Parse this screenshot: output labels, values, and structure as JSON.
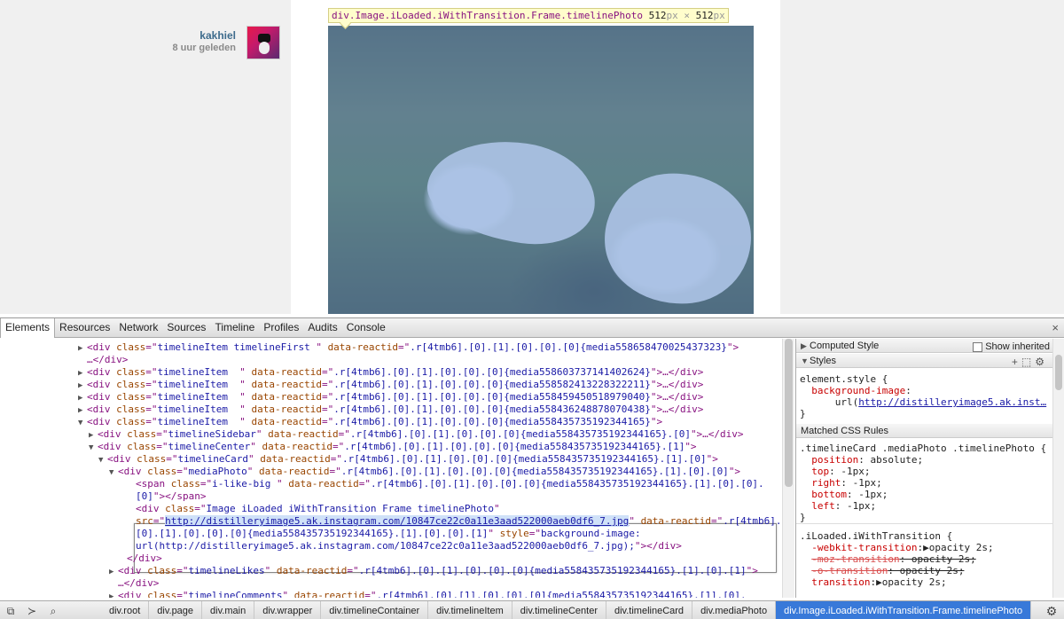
{
  "page": {
    "author_name": "kakhiel",
    "time_ago": "8 uur geleden",
    "tooltip": {
      "selector": "div.Image.iLoaded.iWithTransition.Frame.timelinePhoto",
      "width": "512",
      "height": "512",
      "unit": "px",
      "sep": " × "
    }
  },
  "devtools": {
    "tabs": [
      "Elements",
      "Resources",
      "Network",
      "Sources",
      "Timeline",
      "Profiles",
      "Audits",
      "Console"
    ],
    "close_glyph": "×",
    "dom": [
      {
        "i": 98,
        "tri": "▶",
        "parts": [
          [
            "tg",
            "<div "
          ],
          [
            "an",
            "class"
          ],
          [
            "tg",
            "=\""
          ],
          [
            "av",
            "timelineItem timelineFirst "
          ],
          [
            "tg",
            "\" "
          ],
          [
            "an",
            "data-reactid"
          ],
          [
            "tg",
            "=\""
          ],
          [
            "av",
            ".r[4tmb6].[0].[1].[0].[0].[0]{media558658470025437323}"
          ],
          [
            "tg",
            "\">"
          ]
        ]
      },
      {
        "i": 98,
        "tri": "",
        "parts": [
          [
            "tg",
            "…</div>"
          ]
        ]
      },
      {
        "i": 98,
        "tri": "▶",
        "parts": [
          [
            "tg",
            "<div "
          ],
          [
            "an",
            "class"
          ],
          [
            "tg",
            "=\""
          ],
          [
            "av",
            "timelineItem  "
          ],
          [
            "tg",
            "\" "
          ],
          [
            "an",
            "data-reactid"
          ],
          [
            "tg",
            "=\""
          ],
          [
            "av",
            ".r[4tmb6].[0].[1].[0].[0].[0]{media558603737141402624}"
          ],
          [
            "tg",
            "\">…</div>"
          ]
        ]
      },
      {
        "i": 98,
        "tri": "▶",
        "parts": [
          [
            "tg",
            "<div "
          ],
          [
            "an",
            "class"
          ],
          [
            "tg",
            "=\""
          ],
          [
            "av",
            "timelineItem  "
          ],
          [
            "tg",
            "\" "
          ],
          [
            "an",
            "data-reactid"
          ],
          [
            "tg",
            "=\""
          ],
          [
            "av",
            ".r[4tmb6].[0].[1].[0].[0].[0]{media558582413228322211}"
          ],
          [
            "tg",
            "\">…</div>"
          ]
        ]
      },
      {
        "i": 98,
        "tri": "▶",
        "parts": [
          [
            "tg",
            "<div "
          ],
          [
            "an",
            "class"
          ],
          [
            "tg",
            "=\""
          ],
          [
            "av",
            "timelineItem  "
          ],
          [
            "tg",
            "\" "
          ],
          [
            "an",
            "data-reactid"
          ],
          [
            "tg",
            "=\""
          ],
          [
            "av",
            ".r[4tmb6].[0].[1].[0].[0].[0]{media558459450518979040}"
          ],
          [
            "tg",
            "\">…</div>"
          ]
        ]
      },
      {
        "i": 98,
        "tri": "▶",
        "parts": [
          [
            "tg",
            "<div "
          ],
          [
            "an",
            "class"
          ],
          [
            "tg",
            "=\""
          ],
          [
            "av",
            "timelineItem  "
          ],
          [
            "tg",
            "\" "
          ],
          [
            "an",
            "data-reactid"
          ],
          [
            "tg",
            "=\""
          ],
          [
            "av",
            ".r[4tmb6].[0].[1].[0].[0].[0]{media558436248878070438}"
          ],
          [
            "tg",
            "\">…</div>"
          ]
        ]
      },
      {
        "i": 98,
        "tri": "▼",
        "parts": [
          [
            "tg",
            "<div "
          ],
          [
            "an",
            "class"
          ],
          [
            "tg",
            "=\""
          ],
          [
            "av",
            "timelineItem  "
          ],
          [
            "tg",
            "\" "
          ],
          [
            "an",
            "data-reactid"
          ],
          [
            "tg",
            "=\""
          ],
          [
            "av",
            ".r[4tmb6].[0].[1].[0].[0].[0]{media558435735192344165}"
          ],
          [
            "tg",
            "\">"
          ]
        ]
      },
      {
        "i": 110,
        "tri": "▶",
        "parts": [
          [
            "tg",
            "<div "
          ],
          [
            "an",
            "class"
          ],
          [
            "tg",
            "=\""
          ],
          [
            "av",
            "timelineSidebar"
          ],
          [
            "tg",
            "\" "
          ],
          [
            "an",
            "data-reactid"
          ],
          [
            "tg",
            "=\""
          ],
          [
            "av",
            ".r[4tmb6].[0].[1].[0].[0].[0]{media558435735192344165}.[0]"
          ],
          [
            "tg",
            "\">…</div>"
          ]
        ]
      },
      {
        "i": 110,
        "tri": "▼",
        "parts": [
          [
            "tg",
            "<div "
          ],
          [
            "an",
            "class"
          ],
          [
            "tg",
            "=\""
          ],
          [
            "av",
            "timelineCenter"
          ],
          [
            "tg",
            "\" "
          ],
          [
            "an",
            "data-reactid"
          ],
          [
            "tg",
            "=\""
          ],
          [
            "av",
            ".r[4tmb6].[0].[1].[0].[0].[0]{media558435735192344165}.[1]"
          ],
          [
            "tg",
            "\">"
          ]
        ]
      },
      {
        "i": 121,
        "tri": "▼",
        "parts": [
          [
            "tg",
            "<div "
          ],
          [
            "an",
            "class"
          ],
          [
            "tg",
            "=\""
          ],
          [
            "av",
            "timelineCard"
          ],
          [
            "tg",
            "\" "
          ],
          [
            "an",
            "data-reactid"
          ],
          [
            "tg",
            "=\""
          ],
          [
            "av",
            ".r[4tmb6].[0].[1].[0].[0].[0]{media558435735192344165}.[1].[0]"
          ],
          [
            "tg",
            "\">"
          ]
        ]
      },
      {
        "i": 133,
        "tri": "▼",
        "parts": [
          [
            "tg",
            "<div "
          ],
          [
            "an",
            "class"
          ],
          [
            "tg",
            "=\""
          ],
          [
            "av",
            "mediaPhoto"
          ],
          [
            "tg",
            "\" "
          ],
          [
            "an",
            "data-reactid"
          ],
          [
            "tg",
            "=\""
          ],
          [
            "av",
            ".r[4tmb6].[0].[1].[0].[0].[0]{media558435735192344165}.[1].[0].[0]"
          ],
          [
            "tg",
            "\">"
          ]
        ]
      },
      {
        "i": 153,
        "tri": "",
        "parts": [
          [
            "tg",
            "<span "
          ],
          [
            "an",
            "class"
          ],
          [
            "tg",
            "=\""
          ],
          [
            "av",
            "i-like-big "
          ],
          [
            "tg",
            "\" "
          ],
          [
            "an",
            "data-reactid"
          ],
          [
            "tg",
            "=\""
          ],
          [
            "av",
            ".r[4tmb6].[0].[1].[0].[0].[0]{media558435735192344165}.[1].[0].[0]."
          ]
        ]
      },
      {
        "i": 153,
        "tri": "",
        "parts": [
          [
            "av",
            "[0]"
          ],
          [
            "tg",
            "\"></span>"
          ]
        ]
      },
      {
        "i": 153,
        "tri": "",
        "parts": [
          [
            "tg",
            "<div "
          ],
          [
            "an",
            "class"
          ],
          [
            "tg",
            "=\""
          ],
          [
            "av",
            "Image iLoaded iWithTransition Frame timelinePhoto"
          ],
          [
            "tg",
            "\""
          ]
        ]
      },
      {
        "i": 153,
        "tri": "",
        "parts": [
          [
            "an",
            "src"
          ],
          [
            "tg",
            "=\""
          ],
          [
            "link",
            "http://distilleryimage5.ak.instagram.com/10847ce22c0a11e3aad522000aeb0df6_7.jpg"
          ],
          [
            "tg",
            "\" "
          ],
          [
            "an",
            "data-reactid"
          ],
          [
            "tg",
            "=\""
          ],
          [
            "av",
            ".r[4tmb6]."
          ]
        ]
      },
      {
        "i": 153,
        "tri": "",
        "parts": [
          [
            "av",
            "[0].[1].[0].[0].[0]{media558435735192344165}.[1].[0].[0].[1]"
          ],
          [
            "tg",
            "\" "
          ],
          [
            "an",
            "style"
          ],
          [
            "tg",
            "=\""
          ],
          [
            "av",
            "background-image:"
          ]
        ]
      },
      {
        "i": 153,
        "tri": "",
        "parts": [
          [
            "av",
            "url(http://distilleryimage5.ak.instagram.com/10847ce22c0a11e3aad522000aeb0df6_7.jpg);"
          ],
          [
            "tg",
            "\"></div>"
          ]
        ]
      },
      {
        "i": 143,
        "tri": "",
        "parts": [
          [
            "tg",
            "</div>"
          ]
        ]
      },
      {
        "i": 133,
        "tri": "▶",
        "parts": [
          [
            "tg",
            "<div "
          ],
          [
            "an",
            "class"
          ],
          [
            "tg",
            "=\""
          ],
          [
            "av",
            "timelineLikes"
          ],
          [
            "tg",
            "\" "
          ],
          [
            "an",
            "data-reactid"
          ],
          [
            "tg",
            "=\""
          ],
          [
            "av",
            ".r[4tmb6].[0].[1].[0].[0].[0]{media558435735192344165}.[1].[0].[1]"
          ],
          [
            "tg",
            "\">"
          ]
        ]
      },
      {
        "i": 133,
        "tri": "",
        "parts": [
          [
            "tg",
            "…</div>"
          ]
        ]
      },
      {
        "i": 133,
        "tri": "▶",
        "parts": [
          [
            "tg",
            "<div "
          ],
          [
            "an",
            "class"
          ],
          [
            "tg",
            "=\""
          ],
          [
            "av",
            "timelineComments"
          ],
          [
            "tg",
            "\" "
          ],
          [
            "an",
            "data-reactid"
          ],
          [
            "tg",
            "=\""
          ],
          [
            "av",
            ".r[4tmb6].[0].[1].[0].[0].[0]{media558435735192344165}.[1].[0]."
          ]
        ]
      }
    ],
    "sidebar": {
      "computed_style": "Computed Style",
      "show_inherited": "Show inherited",
      "styles": "Styles",
      "element_style_lines": [
        "element.style {",
        "  background-image:",
        "      url(http://distilleryimage5.ak.inst…",
        "}"
      ],
      "matched_rules": "Matched CSS Rules",
      "rule1_lines": [
        ".timelineCard .mediaPhoto .timelinePhoto {",
        "  position: absolute;",
        "  top: -1px;",
        "  right: -1px;",
        "  bottom: -1px;",
        "  left: -1px;",
        "}"
      ],
      "rule2_lines": [
        ".iLoaded.iWithTransition {",
        "  -webkit-transition:▶opacity 2s;",
        "  -moz-transition: opacity 2s;",
        "  -o-transition: opacity 2s;",
        "  transition:▶opacity 2s;"
      ]
    },
    "breadcrumbs": [
      "div.root",
      "div.page",
      "div.main",
      "div.wrapper",
      "div.timelineContainer",
      "div.timelineItem",
      "div.timelineCenter",
      "div.timelineCard",
      "div.mediaPhoto",
      "div.Image.iLoaded.iWithTransition.Frame.timelinePhoto"
    ]
  }
}
